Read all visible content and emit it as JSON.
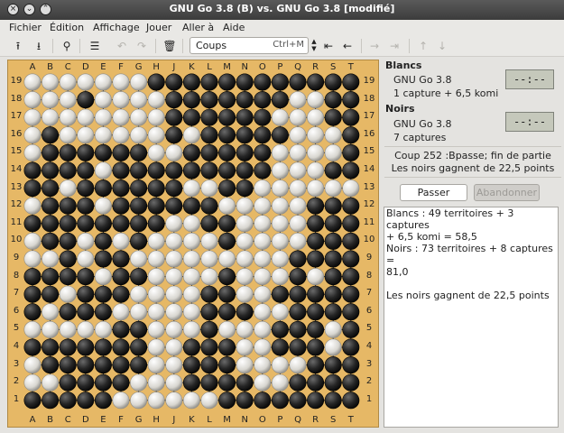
{
  "window": {
    "title": "GNU Go 3.8 (B) vs. GNU Go 3.8 [modifié]"
  },
  "menubar": {
    "items": [
      "Fichier",
      "Édition",
      "Affichage",
      "Jouer",
      "Aller à",
      "Aide"
    ]
  },
  "toolbar": {
    "icons": [
      "save-icon",
      "open-icon",
      "find-icon",
      "menu-icon",
      "undo-icon",
      "redo-icon",
      "trash-icon",
      "back-start-icon",
      "back-icon",
      "forward-icon",
      "forward-end-icon",
      "up-icon",
      "down-icon"
    ],
    "moves_label": "Coups",
    "moves_shortcut": "Ctrl+M"
  },
  "board": {
    "columns": [
      "A",
      "B",
      "C",
      "D",
      "E",
      "F",
      "G",
      "H",
      "J",
      "K",
      "L",
      "M",
      "N",
      "O",
      "P",
      "Q",
      "R",
      "S",
      "T"
    ],
    "rows": [
      "19",
      "18",
      "17",
      "16",
      "15",
      "14",
      "13",
      "12",
      "11",
      "10",
      "9",
      "8",
      "7",
      "6",
      "5",
      "4",
      "3",
      "2",
      "1"
    ],
    "position": [
      "wwwwwwwbbbbbbbbbbbb",
      "wwwbwwwwbbbbbbbwwbb",
      "wwwwwwwwbbbbbbwwwbb",
      "wbwwwwwwbwbbbbbwwwb",
      "wbbbbbbwwbbbbbwwwwb",
      "bbbbwbbbbbbbbbwwwbb",
      "bbwbbbbbbwwbbwwwwww",
      "wbbbwbbbbbbwwwwwbbb",
      "bbbbbbbbwwbbwwwwbbb",
      "wbbwbwbwwwwbwwwwbbb",
      "wwbwbbwwwwwwwwwbbbb",
      "bbbbwbbwwwwbwwwbwbb",
      "bbwbbbwwwwbbwwbbbbb",
      "bwbbbwwwwwbbbwwbbbb",
      "wwwwwbbwwwbwwwbbbwb",
      "bbbbbbbwwbbbwwbbbwb",
      "wbbbbbbwwbbbwwwwbbb",
      "wwbbbbwwwbbbbwwbbbb",
      "bbbbbwwwwwwbbbbbbbb"
    ]
  },
  "white": {
    "name": "Blancs",
    "engine": "GNU Go 3.8",
    "info": "1 capture + 6,5 komi",
    "clock": "--:--"
  },
  "black": {
    "name": "Noirs",
    "engine": "GNU Go 3.8",
    "info": "7 captures",
    "clock": "--:--"
  },
  "status": {
    "line1": "Coup 252 :Bpasse; fin de partie",
    "line2": "Les noirs gagnent de 22,5 points"
  },
  "buttons": {
    "pass": "Passer",
    "resign": "Abandonner"
  },
  "result": {
    "l1": "Blancs : 49 territoires + 3 captures",
    "l2": "+ 6,5 komi = 58,5",
    "l3": "Noirs : 73 territoires + 8 captures =",
    "l4": "81,0",
    "l5": "Les noirs gagnent de 22,5 points"
  }
}
